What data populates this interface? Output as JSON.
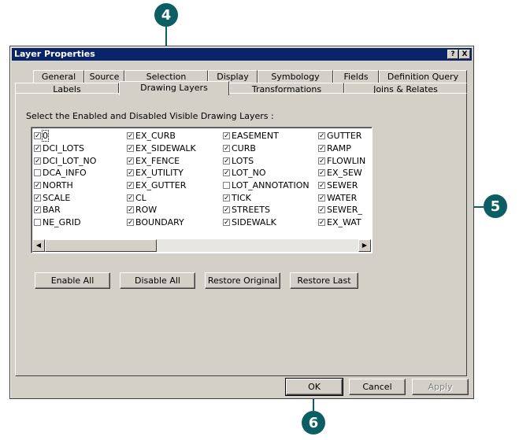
{
  "callouts": [
    "4",
    "5",
    "6"
  ],
  "dialog": {
    "title": "Layer Properties",
    "help_button": "?",
    "close_button": "X"
  },
  "tabs_row1": [
    "General",
    "Source",
    "Selection",
    "Display",
    "Symbology",
    "Fields",
    "Definition Query"
  ],
  "tabs_row2": [
    "Labels",
    "Drawing Layers",
    "Transformations",
    "Joins & Relates"
  ],
  "active_tab": "Drawing Layers",
  "instruction": "Select the Enabled and Disabled Visible Drawing  Layers :",
  "layers": {
    "col1": [
      {
        "label": "0",
        "checked": true
      },
      {
        "label": "DCI_LOTS",
        "checked": true
      },
      {
        "label": "DCI_LOT_NO",
        "checked": true
      },
      {
        "label": "DCA_INFO",
        "checked": false
      },
      {
        "label": "NORTH",
        "checked": true
      },
      {
        "label": "SCALE",
        "checked": true
      },
      {
        "label": "BAR",
        "checked": true
      },
      {
        "label": "NE_GRID",
        "checked": false
      }
    ],
    "col2": [
      {
        "label": "EX_CURB",
        "checked": true
      },
      {
        "label": "EX_SIDEWALK",
        "checked": true
      },
      {
        "label": "EX_FENCE",
        "checked": true
      },
      {
        "label": "EX_UTILITY",
        "checked": true
      },
      {
        "label": "EX_GUTTER",
        "checked": true
      },
      {
        "label": "CL",
        "checked": true
      },
      {
        "label": "ROW",
        "checked": true
      },
      {
        "label": "BOUNDARY",
        "checked": true
      }
    ],
    "col3": [
      {
        "label": "EASEMENT",
        "checked": true
      },
      {
        "label": "CURB",
        "checked": true
      },
      {
        "label": "LOTS",
        "checked": true
      },
      {
        "label": "LOT_NO",
        "checked": true
      },
      {
        "label": "LOT_ANNOTATION",
        "checked": false
      },
      {
        "label": "TICK",
        "checked": true
      },
      {
        "label": "STREETS",
        "checked": true
      },
      {
        "label": "SIDEWALK",
        "checked": true
      }
    ],
    "col4": [
      {
        "label": "GUTTER",
        "checked": true
      },
      {
        "label": "RAMP",
        "checked": true
      },
      {
        "label": "FLOWLIN",
        "checked": true
      },
      {
        "label": "EX_SEW",
        "checked": true
      },
      {
        "label": "SEWER",
        "checked": true
      },
      {
        "label": "WATER",
        "checked": true
      },
      {
        "label": "SEWER_",
        "checked": true
      },
      {
        "label": "EX_WAT",
        "checked": true
      }
    ]
  },
  "scroll": {
    "left_arrow": "◀",
    "right_arrow": "▶"
  },
  "buttons": {
    "enable_all": "Enable All",
    "disable_all": "Disable All",
    "restore_original": "Restore Original",
    "restore_last": "Restore Last",
    "ok": "OK",
    "cancel": "Cancel",
    "apply": "Apply"
  },
  "check_glyph": "✓",
  "colors": {
    "callout": "#0b5e63",
    "titlebar": "#0a246a",
    "face": "#d4d0c8"
  }
}
